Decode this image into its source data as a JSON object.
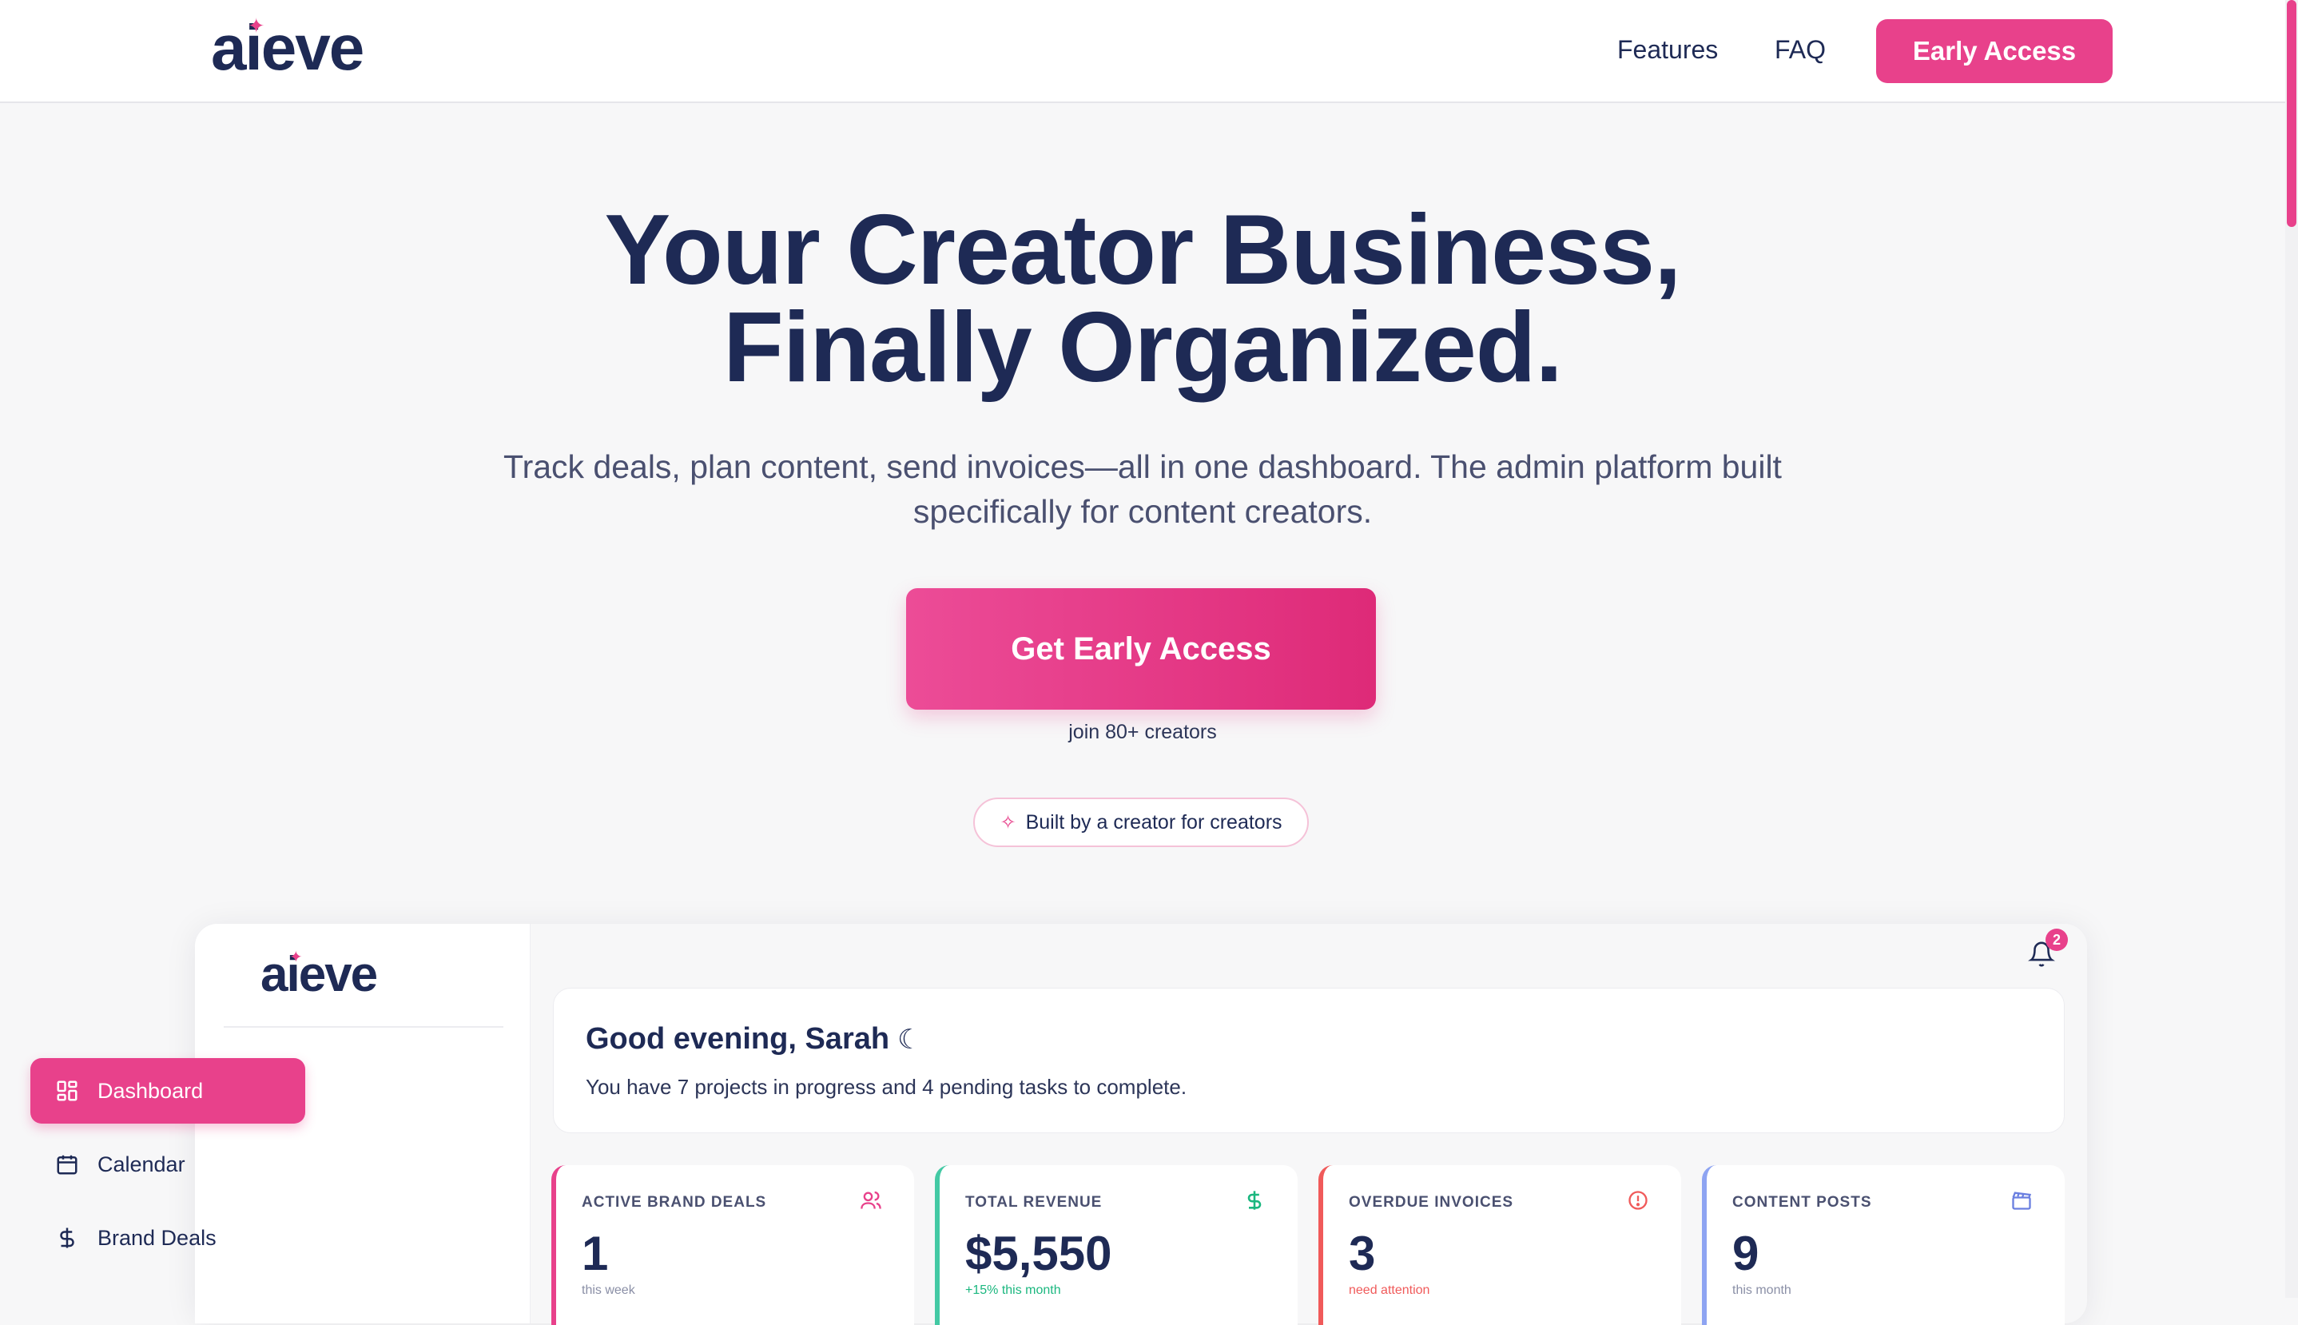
{
  "header": {
    "logo_text": "aieve",
    "nav": {
      "features": "Features",
      "faq": "FAQ"
    },
    "cta_label": "Early Access"
  },
  "hero": {
    "title_line1": "Your Creator Business,",
    "title_line2": "Finally Organized.",
    "subtitle": "Track deals, plan content, send invoices—all in one dashboard. The admin platform built specifically for content creators.",
    "cta_label": "Get Early Access",
    "join_text": "join 80+ creators",
    "badge_text": "Built by a creator for creators"
  },
  "dashboard": {
    "logo_text": "aieve",
    "sidebar": {
      "items": [
        {
          "label": "Dashboard",
          "icon": "grid-icon",
          "active": true
        },
        {
          "label": "Calendar",
          "icon": "calendar-icon",
          "active": false
        },
        {
          "label": "Brand Deals",
          "icon": "dollar-icon",
          "active": false
        }
      ]
    },
    "notifications_count": "2",
    "greeting": {
      "title": "Good evening, Sarah",
      "subtitle": "You have 7 projects in progress and 4 pending tasks to complete."
    },
    "stats": [
      {
        "label": "ACTIVE BRAND DEALS",
        "value": "1",
        "note": "this week",
        "icon": "users-icon",
        "color": "#e8418b"
      },
      {
        "label": "TOTAL REVENUE",
        "value": "$5,550",
        "note": "+15% this month",
        "icon": "dollar-icon",
        "color": "#43c9a4"
      },
      {
        "label": "OVERDUE INVOICES",
        "value": "3",
        "note": "need attention",
        "icon": "alert-icon",
        "color": "#f05a5a"
      },
      {
        "label": "CONTENT POSTS",
        "value": "9",
        "note": "this month",
        "icon": "clapperboard-icon",
        "color": "#8ea4f2"
      }
    ]
  },
  "colors": {
    "brand_pink": "#e8418b",
    "navy_text": "#1e2a55",
    "page_background": "#f7f7f8"
  }
}
